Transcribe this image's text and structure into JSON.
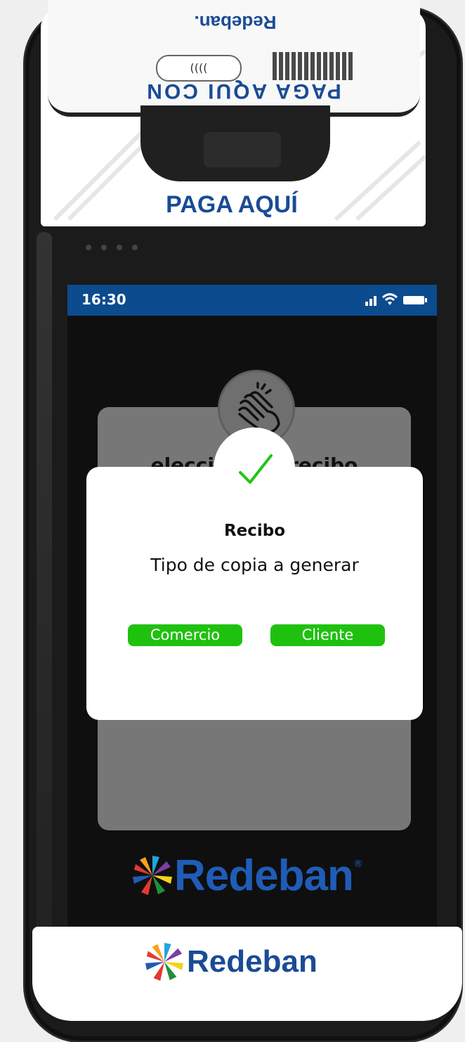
{
  "device": {
    "top_brand_flipped": "Redeban.",
    "top_tagline_flipped": "PAGA AQUI CON",
    "nfc_label": "((((",
    "pay_here_label": "PAGA AQUÍ",
    "bottom_brand": "Redeban"
  },
  "status_bar": {
    "time": "16:30",
    "icons": [
      "signal-icon",
      "wifi-icon",
      "battery-icon"
    ],
    "background": "#0b4b8e"
  },
  "background_card": {
    "text": "elecciona el recibo",
    "icon": "hand-tap-icon"
  },
  "dialog": {
    "icon": "checkmark-icon",
    "title": "Recibo",
    "subtitle": "Tipo de copia a generar",
    "buttons": [
      {
        "label": "Comercio"
      },
      {
        "label": "Cliente"
      }
    ],
    "button_color": "#1fc10f",
    "check_color": "#22c312"
  },
  "screen_brand": {
    "word": "Redeban",
    "registered": "®",
    "color": "#1f5cb8"
  }
}
